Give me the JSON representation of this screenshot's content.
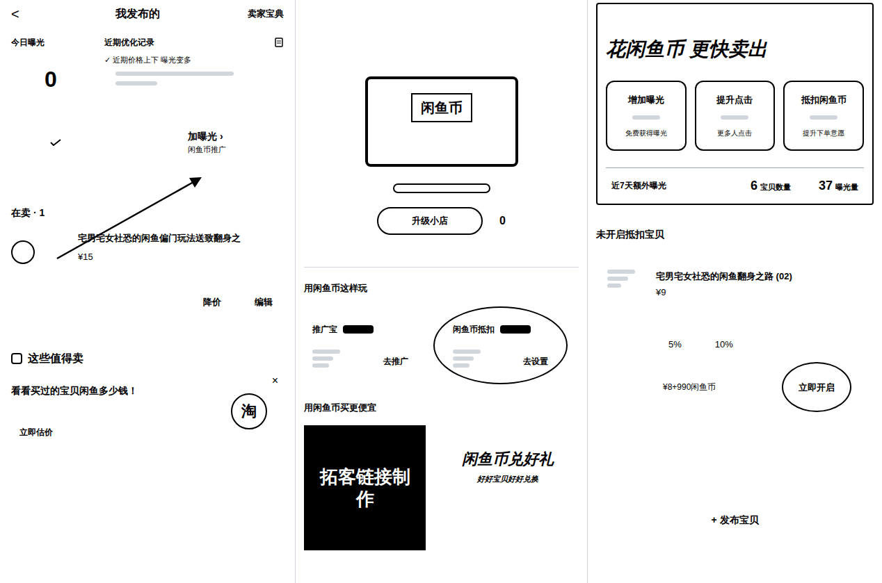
{
  "left": {
    "header": {
      "back": "<",
      "title": "我发布的",
      "action": "卖家宝典"
    },
    "exposure": {
      "label": "今日曝光",
      "value": "0"
    },
    "records": {
      "title": "近期优化记录",
      "note": "✓ 近期价格上下 曝光变多"
    },
    "boost": {
      "title": "加曝光 ›",
      "subtitle": "闲鱼币推广"
    },
    "on_sale": "在卖 · 1",
    "item": {
      "title": "宅男宅女社恐的闲鱼偏门玩法送致翻身之",
      "price": "¥15",
      "actions": [
        "降价",
        "编辑"
      ]
    },
    "worth": {
      "title": "这些值得卖",
      "prompt": "看看买过的宝贝闲鱼多少钱！",
      "close": "×",
      "button": "立即估价",
      "logo": "淘"
    }
  },
  "middle": {
    "shop_sign": "闲鱼币",
    "upgrade": "升级小店",
    "coin_count": "0",
    "section_title": "用闲鱼币这样玩",
    "cards": [
      {
        "title": "推广宝",
        "action": "去推广",
        "highlighted": false
      },
      {
        "title": "闲鱼币抵扣",
        "action": "去设置",
        "highlighted": true
      }
    ],
    "buy_title": "用闲鱼币买更便宜",
    "banners": [
      {
        "title": "拓客链接制作"
      },
      {
        "title": "闲鱼币兑好礼",
        "subtitle": "好好宝贝好好兑换"
      }
    ]
  },
  "right": {
    "heading": "花闲鱼币 更快卖出",
    "benefits": [
      {
        "title": "增加曝光",
        "desc": "免费获得曝光"
      },
      {
        "title": "提升点击",
        "desc": "更多人点击"
      },
      {
        "title": "抵扣闲鱼币",
        "desc": "提升下单意愿"
      }
    ],
    "stats": {
      "label": "近7天额外曝光",
      "items": [
        {
          "value": "6",
          "unit": "宝贝数量"
        },
        {
          "value": "37",
          "unit": "曝光量"
        }
      ]
    },
    "list_title": "未开启抵扣宝贝",
    "item": {
      "title": "宅男宅女社恐的闲鱼翻身之路 (02)",
      "price": "¥9",
      "rates": [
        {
          "label": "5%",
          "selected": false
        },
        {
          "label": "10%",
          "selected": false
        }
      ],
      "deduct": "¥8+990闲鱼币",
      "button": "立即开启",
      "highlighted": true
    },
    "publish": "+ 发布宝贝"
  }
}
